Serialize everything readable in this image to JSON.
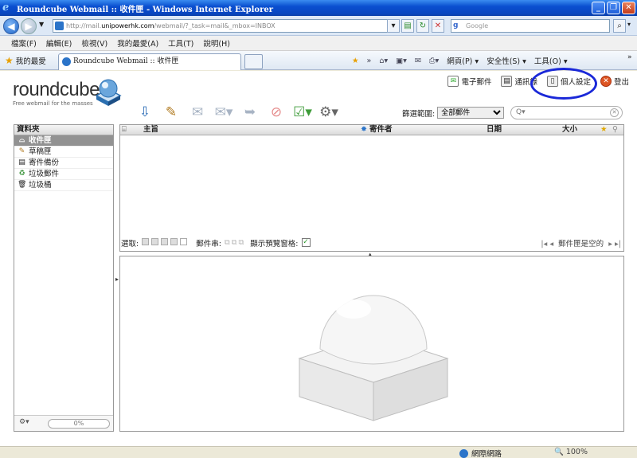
{
  "window": {
    "title": "Roundcube Webmail :: 收件匣 - Windows Internet Explorer"
  },
  "address_bar": {
    "url_prefix": "http://mail.",
    "url_host": "unipowerhk.com",
    "url_path": "/webmail/?_task=mail&_mbox=INBOX",
    "search_placeholder": "Google"
  },
  "menu": [
    "檔案(F)",
    "編輯(E)",
    "檢視(V)",
    "我的最愛(A)",
    "工具(T)",
    "說明(H)"
  ],
  "favbar": {
    "favorites_label": "我的最愛",
    "tab_title": "Roundcube Webmail :: 收件匣",
    "page_menu": "網頁(P) ▾",
    "safety_menu": "安全性(S) ▾",
    "tools_menu": "工具(O) ▾"
  },
  "app": {
    "logo_word": "roundcube",
    "logo_tagline": "Free webmail for the masses",
    "nav": {
      "mail": "電子郵件",
      "addressbook": "通訊錄",
      "settings": "個人設定",
      "logout": "登出"
    },
    "filter_label": "篩選範圍:",
    "filter_value": "全部郵件",
    "quick_search_placeholder": "Q▾"
  },
  "folders": {
    "header": "資料夾",
    "items": [
      {
        "label": "收件匣",
        "icon": "inbox-icon",
        "selected": true
      },
      {
        "label": "草稿匣",
        "icon": "drafts-icon",
        "selected": false
      },
      {
        "label": "寄件備份",
        "icon": "sent-icon",
        "selected": false
      },
      {
        "label": "垃圾郵件",
        "icon": "junk-icon",
        "selected": false
      },
      {
        "label": "垃圾桶",
        "icon": "trash-icon",
        "selected": false
      }
    ],
    "quota": "0%"
  },
  "message_list": {
    "columns": {
      "subject": "主旨",
      "from": "寄件者",
      "date": "日期",
      "size": "大小"
    },
    "footer": {
      "select_label": "選取:",
      "threads_label": "郵件串:",
      "preview_label": "顯示預覽窗格:",
      "empty_message": "郵件匣是空的"
    }
  },
  "statusbar": {
    "zone": "網際網路",
    "zoom": "🔍 100%"
  },
  "colors": {
    "highlight_circle": "#1a28d8",
    "selected_folder": "#929292",
    "titlebar": "#0a4fd0"
  }
}
